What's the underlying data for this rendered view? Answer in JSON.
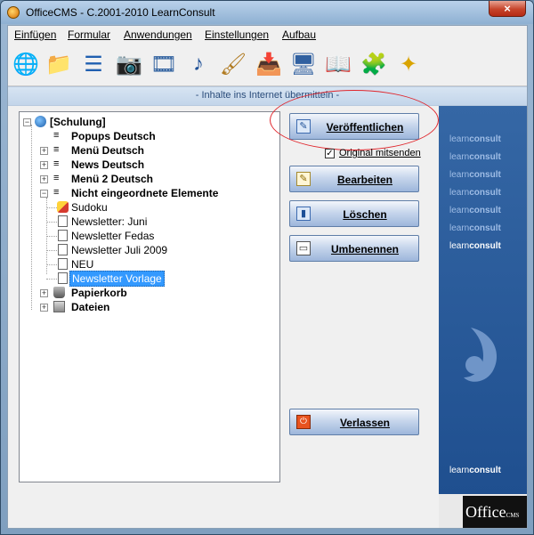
{
  "window": {
    "title": "OfficeCMS - C.2001-2010 LearnConsult",
    "close_label": "×"
  },
  "menu": {
    "items": [
      {
        "label": "Einfügen"
      },
      {
        "label": "Formular"
      },
      {
        "label": "Anwendungen"
      },
      {
        "label": "Einstellungen"
      },
      {
        "label": "Aufbau"
      }
    ]
  },
  "toolbar": {
    "icons": [
      {
        "name": "globe-icon",
        "glyph": "🌐"
      },
      {
        "name": "folder-icon",
        "glyph": "📁"
      },
      {
        "name": "list-icon",
        "glyph": "☰"
      },
      {
        "name": "camera-icon",
        "glyph": "📷"
      },
      {
        "name": "film-icon",
        "glyph": "🎞"
      },
      {
        "name": "music-note-icon",
        "glyph": "♪"
      },
      {
        "name": "brush-icon",
        "glyph": "🖌"
      },
      {
        "name": "download-box-icon",
        "glyph": "📥"
      },
      {
        "name": "monitor-camera-icon",
        "glyph": "🖥"
      },
      {
        "name": "book-icon",
        "glyph": "📖"
      },
      {
        "name": "puzzle-icon",
        "glyph": "🧩"
      },
      {
        "name": "compass-icon",
        "glyph": "✦"
      }
    ]
  },
  "status_strip": {
    "text": "- Inhalte ins Internet übermitteln -"
  },
  "tree": {
    "root": "[Schulung]",
    "nodes": [
      {
        "label": "Popups Deutsch"
      },
      {
        "label": "Menü Deutsch"
      },
      {
        "label": "News Deutsch"
      },
      {
        "label": "Menü 2 Deutsch"
      },
      {
        "label": "Nicht eingeordnete Elemente"
      },
      {
        "label": "Sudoku"
      },
      {
        "label": "Newsletter: Juni"
      },
      {
        "label": "Newsletter Fedas"
      },
      {
        "label": "Newsletter Juli 2009"
      },
      {
        "label": "NEU"
      },
      {
        "label": "Newsletter Vorlage"
      },
      {
        "label": "Papierkorb"
      },
      {
        "label": "Dateien"
      }
    ],
    "expander_plus": "+",
    "expander_minus": "−"
  },
  "buttons": {
    "publish": "Veröffentlichen",
    "original_send": "Original mitsenden",
    "original_send_checked": "✓",
    "edit": "Bearbeiten",
    "delete": "Löschen",
    "rename": "Umbenennen",
    "exit": "Verlassen"
  },
  "side_panel": {
    "brand_light": "learn",
    "brand_bold": "consult"
  },
  "footer": {
    "office_logo": "Office",
    "office_logo_small": "CMS"
  },
  "colors": {
    "accent_blue": "#3399ff",
    "side_panel": "#2a5b99",
    "highlight_oval": "#e0262c"
  }
}
